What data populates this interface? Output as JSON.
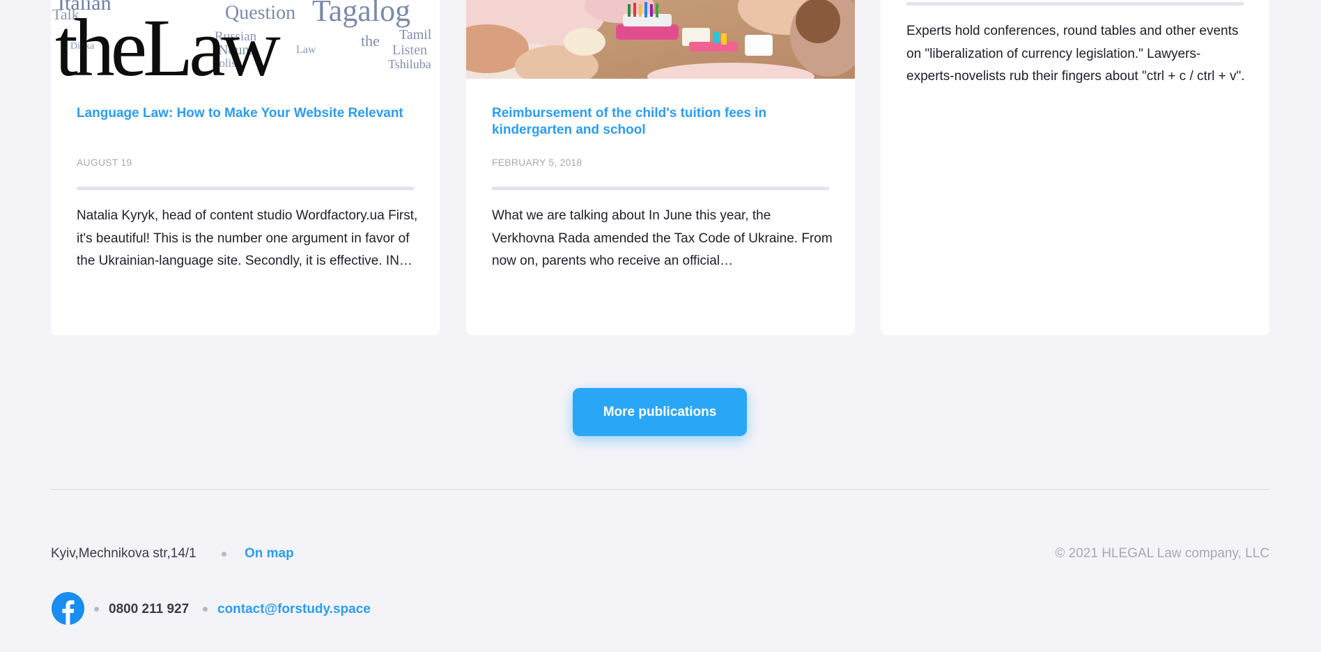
{
  "cards": [
    {
      "title": "Language Law: How to Make Your Website Relevant",
      "date": "AUGUST 19",
      "excerpt": "Natalia Kyryk, head of content studio Wordfactory.ua First, it's beautiful! This is the number one argument in favor of the Ukrainian-language site. Secondly, it is effective. IN…",
      "image_words": [
        "theLaw",
        "Italian",
        "Question",
        "Tagalog",
        "Talk",
        "Russian",
        "Nouns",
        "Polish",
        "Tamil",
        "Listen",
        "Tshiluba",
        "Dinka",
        "the",
        "Law"
      ]
    },
    {
      "title": "Reimbursement of the child's tuition fees in kindergarten and school",
      "date": "FEBRUARY 5, 2018",
      "excerpt": "What we are talking about In June this year, the Verkhovna Rada amended the Tax Code of Ukraine. From now on, parents who receive an official…"
    },
    {
      "excerpt": "Experts hold conferences, round tables and other events on \"liberalization of currency legislation.\" Lawyers-experts-novelists rub their fingers about \"ctrl + c / ctrl + v\"."
    }
  ],
  "more_button": {
    "label": "More publications"
  },
  "footer": {
    "address": "Kyiv,Mechnikova str,14/1",
    "map_link": "On map",
    "copyright": "© 2021 HLEGAL Law company, LLC",
    "phone": "0800 211 927",
    "email": "contact@forstudy.space",
    "social_icon": "facebook-icon"
  },
  "colors": {
    "accent": "#2a9df4",
    "button": "#2aa6f7",
    "background": "#f4f4f8",
    "facebook": "#1a8df0"
  }
}
